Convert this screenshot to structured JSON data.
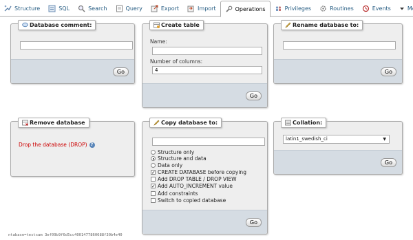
{
  "tabs": [
    {
      "label": "Structure",
      "icon": "structure-icon"
    },
    {
      "label": "SQL",
      "icon": "sql-icon"
    },
    {
      "label": "Search",
      "icon": "search-icon"
    },
    {
      "label": "Query",
      "icon": "query-icon"
    },
    {
      "label": "Export",
      "icon": "export-icon"
    },
    {
      "label": "Import",
      "icon": "import-icon"
    },
    {
      "label": "Operations",
      "icon": "wrench-icon",
      "active": true
    },
    {
      "label": "Privileges",
      "icon": "privileges-icon"
    },
    {
      "label": "Routines",
      "icon": "routines-icon"
    },
    {
      "label": "Events",
      "icon": "events-icon"
    },
    {
      "label": "More",
      "icon": "chevron-down-icon"
    }
  ],
  "db_comment": {
    "legend": "Database comment:",
    "value": "",
    "go": "Go"
  },
  "create_table": {
    "legend": "Create table",
    "name_label": "Name:",
    "name_value": "",
    "columns_label": "Number of columns:",
    "columns_value": "4",
    "go": "Go"
  },
  "rename_db": {
    "legend": "Rename database to:",
    "value": "",
    "go": "Go"
  },
  "remove_db": {
    "legend": "Remove database",
    "drop_link": "Drop the database (DROP)"
  },
  "copy_db": {
    "legend": "Copy database to:",
    "value": "",
    "radios": [
      {
        "label": "Structure only",
        "checked": false
      },
      {
        "label": "Structure and data",
        "checked": true
      },
      {
        "label": "Data only",
        "checked": false
      }
    ],
    "checkboxes": [
      {
        "label": "CREATE DATABASE before copying",
        "checked": true
      },
      {
        "label": "Add DROP TABLE / DROP VIEW",
        "checked": false
      },
      {
        "label": "Add AUTO_INCREMENT value",
        "checked": true
      },
      {
        "label": "Add constraints",
        "checked": false
      },
      {
        "label": "Switch to copied database",
        "checked": false
      }
    ],
    "go": "Go"
  },
  "collation": {
    "legend": "Collation:",
    "selected": "latin1_swedish_ci",
    "go": "Go"
  },
  "status_text": "ntabase=testsam 3ef09b9f6d5cc4001477860688f30b4e40"
}
